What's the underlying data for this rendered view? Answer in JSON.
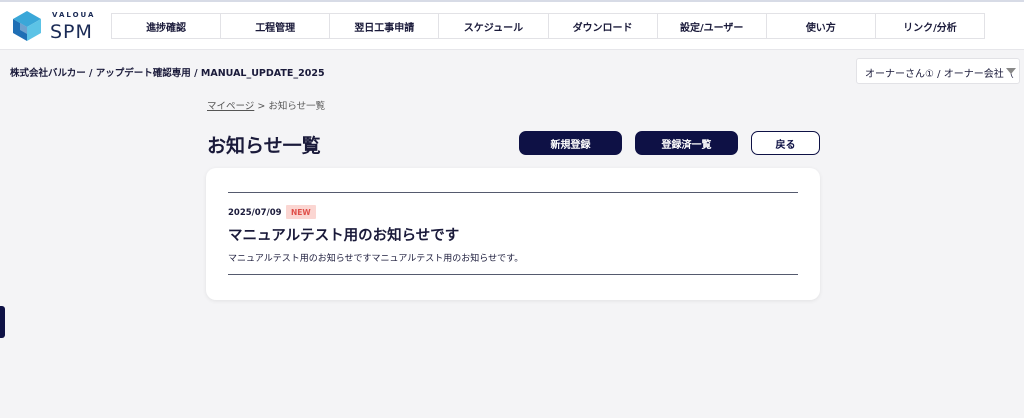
{
  "app": {
    "logo_small": "VALOUA",
    "logo_big": "SPM"
  },
  "nav": {
    "items": [
      {
        "label": "進捗確認"
      },
      {
        "label": "工程管理"
      },
      {
        "label": "翌日工事申請"
      },
      {
        "label": "スケジュール"
      },
      {
        "label": "ダウンロード"
      },
      {
        "label": "設定/ユーザー"
      },
      {
        "label": "使い方"
      },
      {
        "label": "リンク/分析"
      }
    ]
  },
  "context": {
    "company_path": "株式会社バルカー / アップデート確認専用 / MANUAL_UPDATE_2025",
    "user_select_value": "オーナーさん① / オーナー会社（"
  },
  "breadcrumb": {
    "home": "マイページ",
    "separator": " > ",
    "current": "お知らせ一覧"
  },
  "page": {
    "title": "お知らせ一覧"
  },
  "actions": {
    "new_label": "新規登録",
    "list_label": "登録済一覧",
    "back_label": "戻る"
  },
  "notices": [
    {
      "date": "2025/07/09",
      "badge": "NEW",
      "title": "マニュアルテスト用のお知らせです",
      "body": "マニュアルテスト用のお知らせですマニュアルテスト用のお知らせです。"
    }
  ],
  "colors": {
    "primary": "#0e1145",
    "badge_bg": "#fbd6d2",
    "badge_text": "#e0504a",
    "background": "#f4f4f6"
  }
}
